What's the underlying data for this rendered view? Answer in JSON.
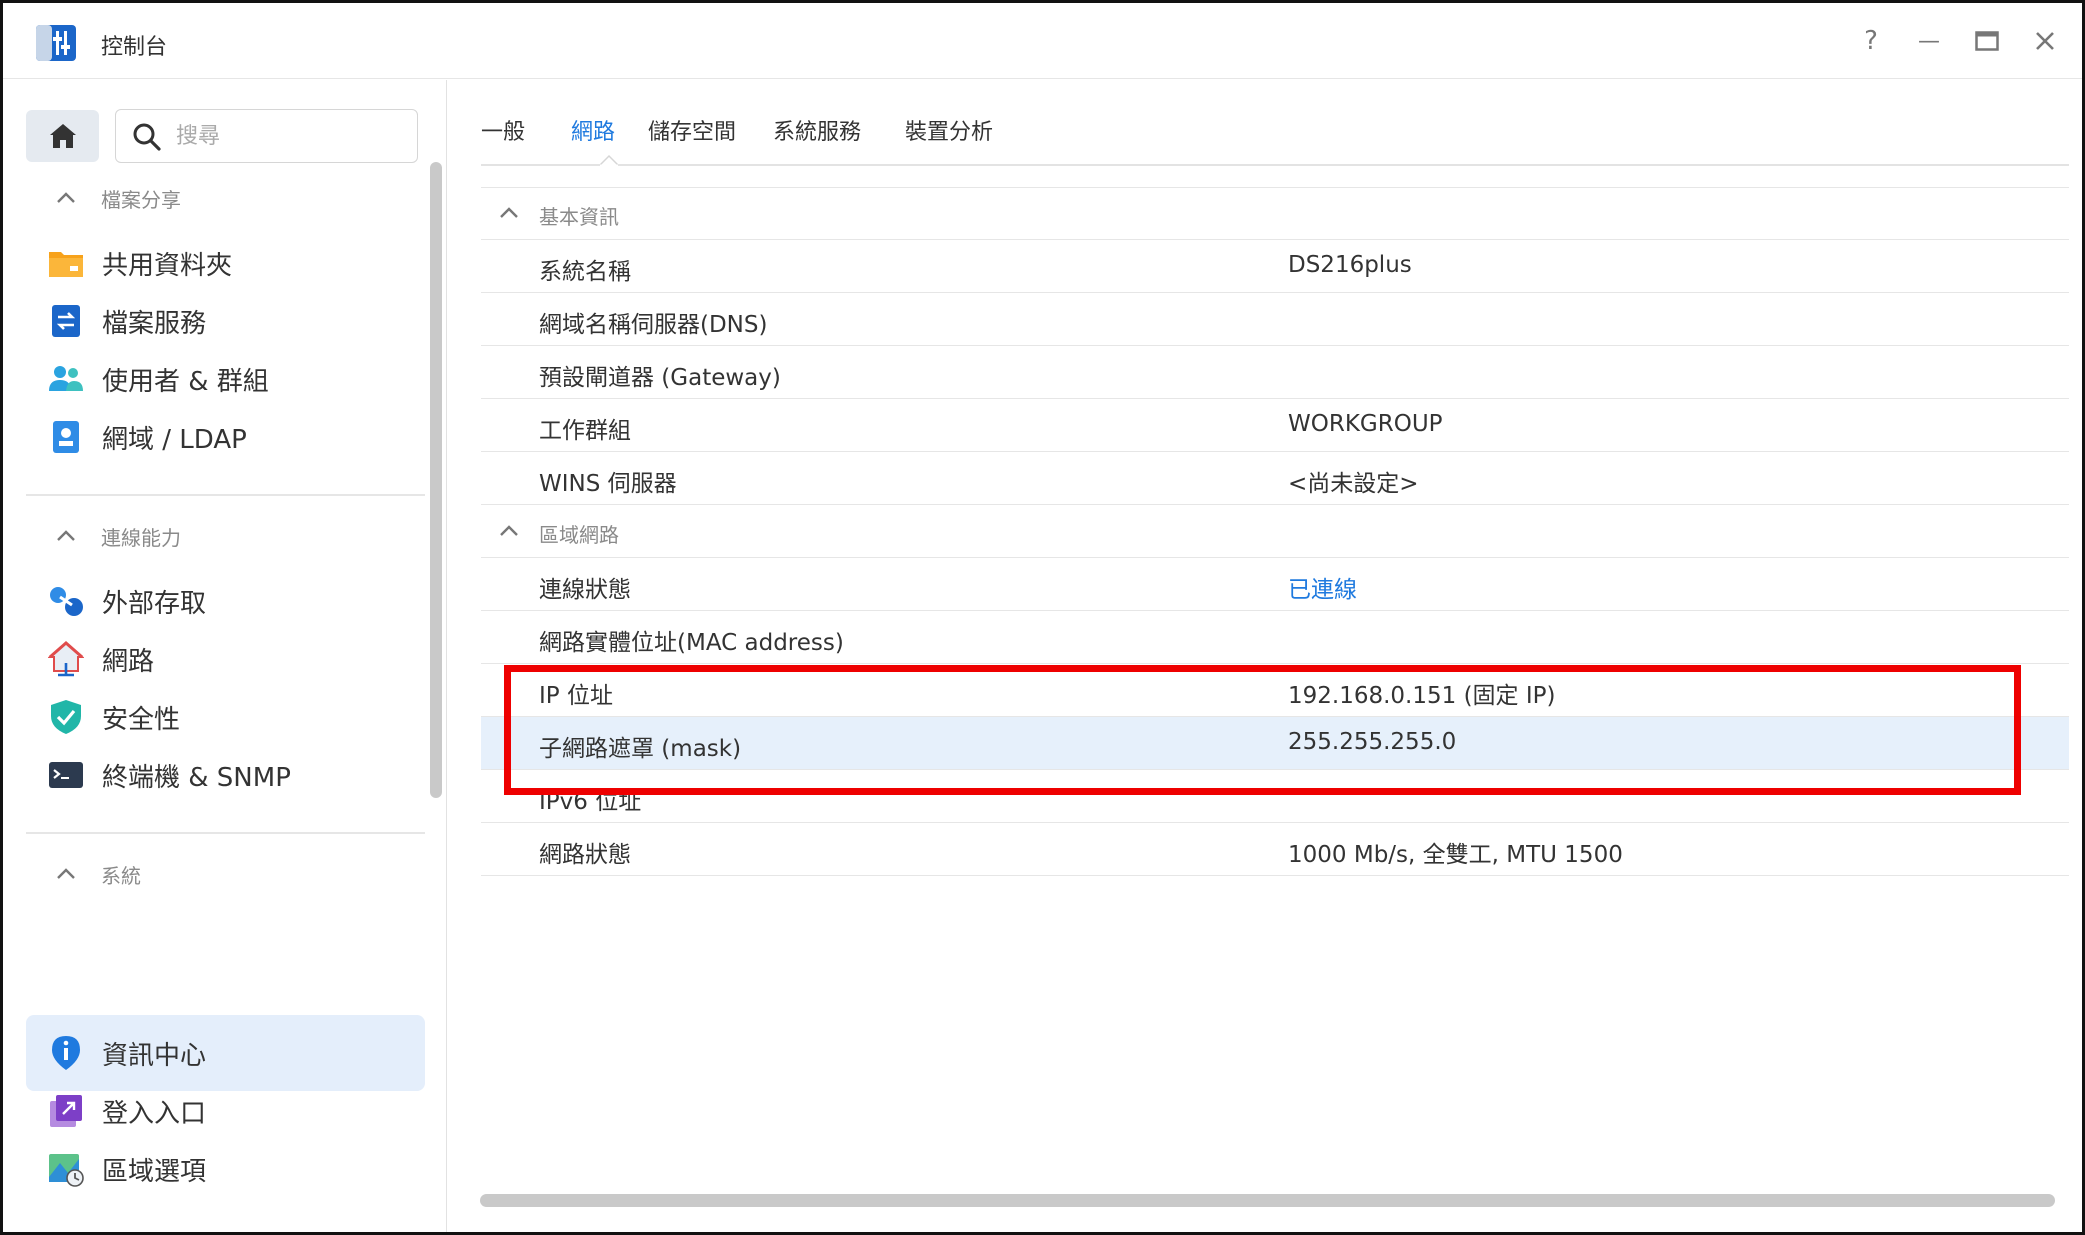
{
  "window": {
    "title": "控制台",
    "buttons": {
      "help": "?",
      "minimize": "—",
      "maximize": "▭",
      "close": "✕"
    }
  },
  "sidebar": {
    "search_placeholder": "搜尋",
    "sections": [
      {
        "label": "檔案分享",
        "items": [
          {
            "label": "共用資料夾",
            "icon": "folder-icon"
          },
          {
            "label": "檔案服務",
            "icon": "file-services-icon"
          },
          {
            "label": "使用者 & 群組",
            "icon": "users-icon"
          },
          {
            "label": "網域 / LDAP",
            "icon": "domain-icon"
          }
        ]
      },
      {
        "label": "連線能力",
        "items": [
          {
            "label": "外部存取",
            "icon": "external-access-icon"
          },
          {
            "label": "網路",
            "icon": "network-house-icon"
          },
          {
            "label": "安全性",
            "icon": "shield-icon"
          },
          {
            "label": "終端機 & SNMP",
            "icon": "terminal-icon"
          }
        ]
      },
      {
        "label": "系統",
        "items": [
          {
            "label": "資訊中心",
            "icon": "info-icon",
            "active": true
          },
          {
            "label": "登入入口",
            "icon": "login-portal-icon"
          },
          {
            "label": "區域選項",
            "icon": "regional-options-icon"
          }
        ]
      }
    ]
  },
  "tabs": [
    {
      "label": "一般"
    },
    {
      "label": "網路",
      "active": true
    },
    {
      "label": "儲存空間"
    },
    {
      "label": "系統服務"
    },
    {
      "label": "裝置分析"
    }
  ],
  "info": {
    "group_basic": "基本資訊",
    "rows_basic": [
      {
        "key": "系統名稱",
        "value": "DS216plus"
      },
      {
        "key": "網域名稱伺服器(DNS)",
        "value": ""
      },
      {
        "key": "預設閘道器 (Gateway)",
        "value": ""
      },
      {
        "key": "工作群組",
        "value": "WORKGROUP"
      },
      {
        "key": "WINS 伺服器",
        "value": "<尚未設定>"
      }
    ],
    "group_lan": "區域網路",
    "rows_lan": [
      {
        "key": "連線狀態",
        "value": "已連線",
        "link": true
      },
      {
        "key": "網路實體位址(MAC address)",
        "value": ""
      },
      {
        "key": "IP 位址",
        "value": "192.168.0.151 (固定 IP)"
      },
      {
        "key": "子網路遮罩 (mask)",
        "value": "255.255.255.0",
        "highlighted": true
      },
      {
        "key": "IPv6 位址",
        "value": ""
      },
      {
        "key": "網路狀態",
        "value": "1000 Mb/s, 全雙工, MTU 1500"
      }
    ]
  },
  "colors": {
    "accent": "#1f7adf",
    "highlight_row": "#e6f0fb",
    "annotation_box": "#ee0000"
  }
}
